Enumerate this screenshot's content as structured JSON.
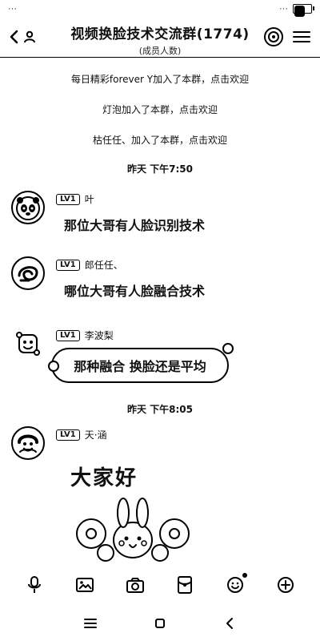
{
  "status_bar": {
    "left_text": "···",
    "right_text": "···"
  },
  "header": {
    "title": "视频换脸技术交流群(1774)",
    "subtitle": "(成员人数)"
  },
  "system_messages": [
    "每日精彩forever Y加入了本群，点击欢迎",
    "灯泡加入了本群，点击欢迎",
    "枯任任、加入了本群，点击欢迎"
  ],
  "timestamps": [
    "昨天 下午7:50",
    "昨天 下午8:05"
  ],
  "messages": [
    {
      "level": "LV1",
      "name": "叶",
      "text": "那位大哥有人脸识别技术"
    },
    {
      "level": "LV1",
      "name": "郎任任、",
      "text": "哪位大哥有人脸融合技术"
    },
    {
      "level": "LV1",
      "name": "李波梨",
      "text": "那种融合 换脸还是平均"
    },
    {
      "level": "LV1",
      "name": "天·涵",
      "text": "大家好"
    }
  ],
  "icons": {
    "back": "back-icon",
    "people": "group-icon",
    "menu": "menu-icon",
    "voice": "mic-icon",
    "image": "image-icon",
    "camera": "camera-icon",
    "red_packet": "red-packet-icon",
    "emoji": "emoji-icon",
    "more": "plus-icon",
    "nav_menu": "menu-nav-icon",
    "nav_home": "home-nav-icon",
    "nav_back": "back-nav-icon"
  }
}
